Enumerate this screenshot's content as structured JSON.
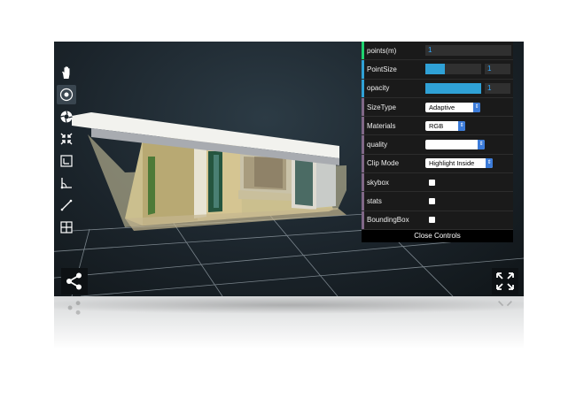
{
  "toolbar": {
    "tools": [
      {
        "icon": "hand-icon",
        "active": false
      },
      {
        "icon": "eye-icon",
        "active": true
      },
      {
        "icon": "aperture-icon",
        "active": false
      },
      {
        "icon": "collapse-arrows-icon",
        "active": false
      },
      {
        "icon": "crop-frame-icon",
        "active": false
      },
      {
        "icon": "angle-measure-icon",
        "active": false
      },
      {
        "icon": "line-measure-icon",
        "active": false
      },
      {
        "icon": "grid-icon",
        "active": false
      }
    ]
  },
  "controls": {
    "points": {
      "label": "points(m)",
      "value": "1",
      "stripe": "#1ed36f"
    },
    "point_size": {
      "label": "PointSize",
      "value": "1",
      "fill": 0.35,
      "stripe": "#2fa1d6"
    },
    "opacity": {
      "label": "opacity",
      "value": "1",
      "fill": 1.0,
      "stripe": "#2fa1d6"
    },
    "size_type": {
      "label": "SizeType",
      "selected": "Adaptive",
      "stripe": "#806787"
    },
    "materials": {
      "label": "Materials",
      "selected": "RGB",
      "stripe": "#806787"
    },
    "quality": {
      "label": "quality",
      "selected": "",
      "stripe": "#806787"
    },
    "clip_mode": {
      "label": "Clip Mode",
      "selected": "Highlight Inside",
      "stripe": "#806787"
    },
    "skybox": {
      "label": "skybox",
      "checked": false,
      "stripe": "#806787"
    },
    "stats": {
      "label": "stats",
      "checked": false,
      "stripe": "#806787"
    },
    "bounding_box": {
      "label": "BoundingBox",
      "checked": false,
      "stripe": "#806787"
    },
    "close_label": "Close Controls"
  },
  "buttons": {
    "share_icon": "share-icon",
    "fullscreen_icon": "fullscreen-icon"
  },
  "colors": {
    "viewer_bg": "#1b242b",
    "panel_bg": "#1a1a1a",
    "accent_blue": "#2fa1d6",
    "number_text": "#33aaff"
  }
}
